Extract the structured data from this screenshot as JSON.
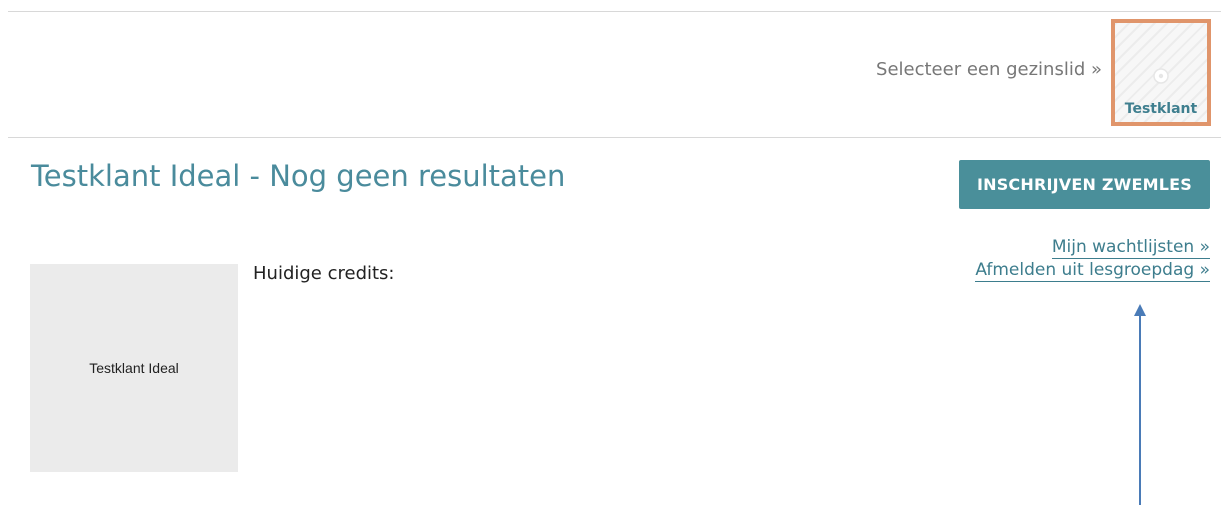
{
  "family_selector": {
    "prompt": "Selecteer een gezinslid »",
    "selected_member": {
      "name": "Testklant",
      "icon": "placeholder-circle-icon"
    }
  },
  "header": {
    "title": "Testklant Ideal - Nog geen resultaten"
  },
  "actions": {
    "enroll_button": "INSCHRIJVEN ZWEMLES",
    "links": [
      "Mijn wachtlijsten »",
      "Afmelden uit lesgroepdag »"
    ]
  },
  "profile": {
    "avatar_alt": "Testklant Ideal",
    "credits_label": "Huidige credits:"
  },
  "colors": {
    "accent": "#4a8f9a",
    "link": "#3d7d8d",
    "selected_border": "#e0956b",
    "annotation_arrow": "#4a7bb7"
  }
}
